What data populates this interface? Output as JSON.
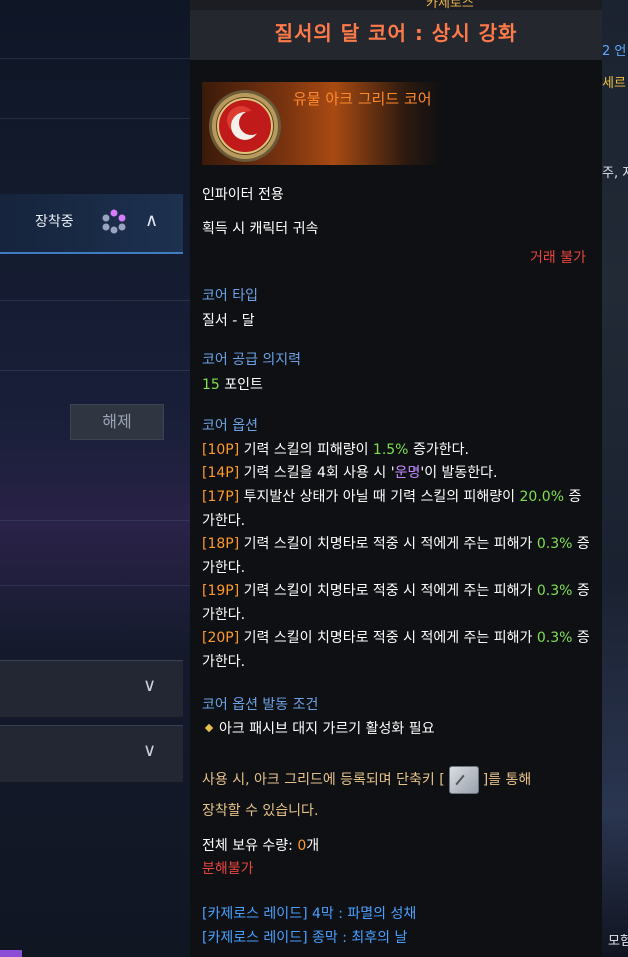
{
  "window": {
    "top_label": "카제로스",
    "title": "질서의 달 코어 : 상시 강화"
  },
  "left_panel": {
    "equipped_label": "장착중",
    "release_button": "해제"
  },
  "right_edge": {
    "snippets": [
      "2 언",
      "세르",
      "주, 저",
      "모험"
    ]
  },
  "item": {
    "icon": "moon-core-icon",
    "name": "유물 아크 그리드 코어",
    "class_restriction": "인파이터 전용",
    "binding": "획득 시 캐릭터 귀속",
    "trade": "거래 불가",
    "core_type_header": "코어 타입",
    "core_type_value": "질서 - 달",
    "willpower_header": "코어 공급 의지력",
    "willpower_value": "15",
    "willpower_unit": " 포인트",
    "options_header": "코어 옵션",
    "options": [
      {
        "tag": "[10P]",
        "pre": " 기력 스킬의 피해량이 ",
        "hl": "1.5%",
        "post": " 증가한다.",
        "hl_color": "green"
      },
      {
        "tag": "[14P]",
        "pre": " 기력 스킬을 4회 사용 시 '",
        "hl": "운명",
        "post": "'이 발동한다.",
        "hl_color": "purple"
      },
      {
        "tag": "[17P]",
        "pre": " 투지발산 상태가 아닐 때 기력 스킬의 피해량이 ",
        "hl": "20.0%",
        "post": " 증가한다.",
        "hl_color": "green"
      },
      {
        "tag": "[18P]",
        "pre": " 기력 스킬이 치명타로 적중 시 적에게 주는 피해가 ",
        "hl": "0.3%",
        "post": " 증가한다.",
        "hl_color": "green"
      },
      {
        "tag": "[19P]",
        "pre": " 기력 스킬이 치명타로 적중 시 적에게 주는 피해가 ",
        "hl": "0.3%",
        "post": " 증가한다.",
        "hl_color": "green"
      },
      {
        "tag": "[20P]",
        "pre": " 기력 스킬이 치명타로 적중 시 적에게 주는 피해가 ",
        "hl": "0.3%",
        "post": " 증가한다.",
        "hl_color": "green"
      }
    ],
    "condition_header": "코어 옵션 발동 조건",
    "condition_text": "아크 패시브 대지 가르기 활성화 필요",
    "usage_line1_pre": "사용 시, 아크 그리드에 등록되며 단축키 [",
    "usage_line1_post": "]를 통해",
    "usage_line2": "장착할 수 있습니다.",
    "owned_label": "전체 보유 수량: ",
    "owned_value": "0",
    "owned_unit": "개",
    "disassemble": "분해불가",
    "sources": [
      "[카제로스 레이드] 4막 : 파멸의 성채",
      "[카제로스 레이드] 종막 : 최후의 날"
    ]
  },
  "colors": {
    "title": "#ff7a4a",
    "header_blue": "#6ba3e6",
    "tag_orange": "#ff9a2a",
    "value_green": "#7ee050",
    "fate_purple": "#c58cff",
    "warning_red": "#e8453c",
    "link_blue": "#4aa0ff"
  }
}
